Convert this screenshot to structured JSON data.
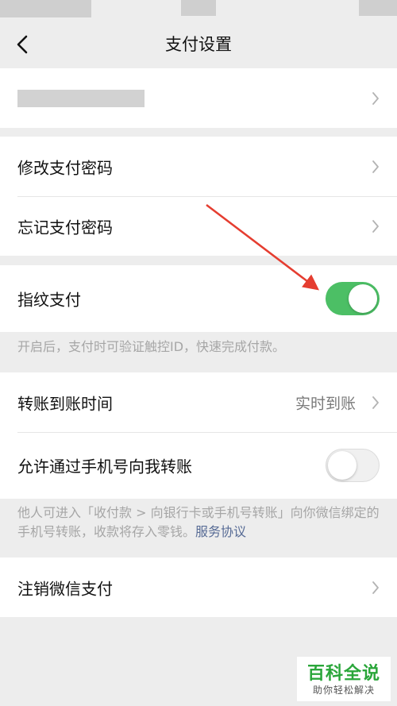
{
  "nav": {
    "title": "支付设置"
  },
  "rows": {
    "change_password": "修改支付密码",
    "forgot_password": "忘记支付密码",
    "fingerprint_pay": "指纹支付",
    "transfer_time": "转账到账时间",
    "transfer_time_value": "实时到账",
    "allow_phone_transfer": "允许通过手机号向我转账",
    "deactivate": "注销微信支付"
  },
  "notes": {
    "fingerprint_note": "开启后，支付时可验证触控ID，快速完成付款。",
    "phone_note": "他人可进入「收付款 > 向银行卡或手机号转账」向你微信绑定的手机号转账，收款将存入零钱。",
    "service_agreement_link": "服务协议"
  },
  "toggles": {
    "fingerprint_pay": true,
    "allow_phone_transfer": false
  },
  "colors": {
    "toggle_on": "#4cbf65",
    "link": "#576b95",
    "arrow": "#e53d30",
    "watermark_green": "#2aa63a"
  },
  "watermark": {
    "title": "百科全说",
    "subtitle": "助你轻松解决"
  },
  "icons": {
    "back": "chevron-left-icon",
    "chevron": "chevron-right-icon"
  }
}
